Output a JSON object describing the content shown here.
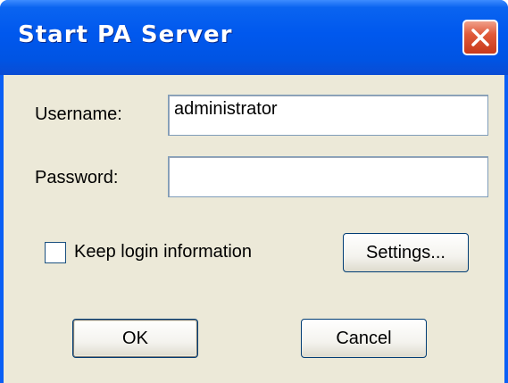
{
  "window": {
    "title": "Start PA Server"
  },
  "close_icon": "close-icon",
  "form": {
    "username_label": "Username:",
    "username_value": "administrator",
    "password_label": "Password:",
    "password_value": "",
    "keep_login_label": "Keep login information",
    "keep_login_checked": false
  },
  "buttons": {
    "settings": "Settings...",
    "ok": "OK",
    "cancel": "Cancel"
  },
  "colors": {
    "titlebar": "#0054e3",
    "close_button": "#e05a3a",
    "dialog_background": "#ece9d8"
  }
}
